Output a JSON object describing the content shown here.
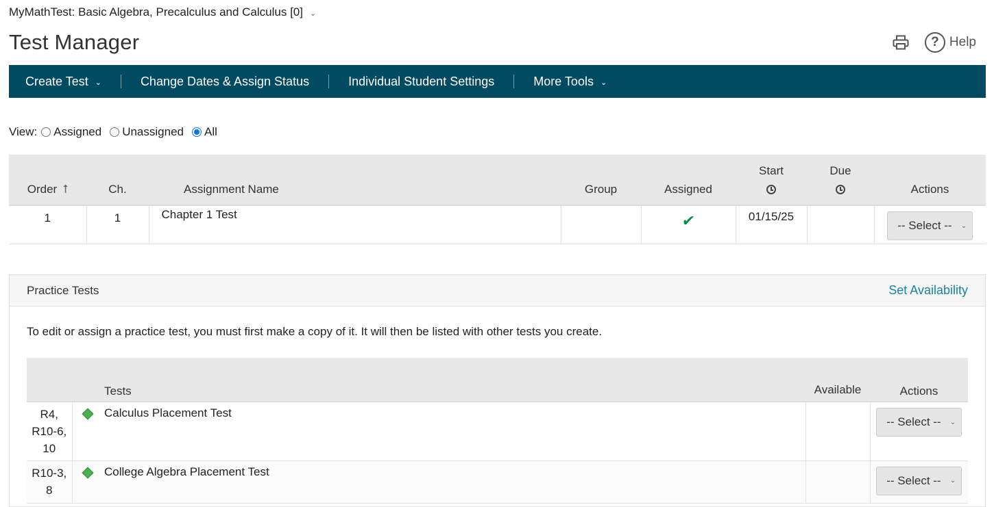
{
  "header": {
    "course_title": "MyMathTest: Basic Algebra, Precalculus and Calculus [0]",
    "course_chevron": "⌄",
    "page_title": "Test Manager",
    "help_label": "Help",
    "help_glyph": "?"
  },
  "nav": {
    "items": [
      {
        "label": "Create Test",
        "has_dropdown": true
      },
      {
        "label": "Change Dates & Assign Status",
        "has_dropdown": false
      },
      {
        "label": "Individual Student Settings",
        "has_dropdown": false
      },
      {
        "label": "More Tools",
        "has_dropdown": true
      }
    ],
    "chevron": "⌄"
  },
  "view_filter": {
    "label": "View:",
    "options": [
      {
        "label": "Assigned",
        "selected": false
      },
      {
        "label": "Unassigned",
        "selected": false
      },
      {
        "label": "All",
        "selected": true
      }
    ]
  },
  "tests_table": {
    "columns": {
      "order": "Order",
      "chapter": "Ch.",
      "name": "Assignment Name",
      "group": "Group",
      "assigned": "Assigned",
      "start": "Start",
      "due": "Due",
      "actions": "Actions"
    },
    "sort_glyph": "⭡",
    "rows": [
      {
        "order": "1",
        "chapter": "1",
        "name": "Chapter 1 Test",
        "group": "",
        "assigned_glyph": "✔",
        "start": "01/15/25",
        "due": "",
        "action": "-- Select --"
      }
    ]
  },
  "practice": {
    "title": "Practice Tests",
    "set_availability": "Set Availability",
    "note": "To edit or assign a practice test, you must first make a copy of it. It will then be listed with other tests you create.",
    "columns": {
      "tests": "Tests",
      "available": "Available",
      "actions": "Actions"
    },
    "rows": [
      {
        "chapters": [
          "R4,",
          "R10-6,",
          "10"
        ],
        "name": "Calculus Placement Test",
        "available": "",
        "action": "-- Select --"
      },
      {
        "chapters": [
          "R10-3,",
          "8"
        ],
        "name": "College Algebra Placement Test",
        "available": "",
        "action": "-- Select --"
      }
    ]
  },
  "select_chevron": "⌄",
  "colors": {
    "nav_bg": "#004a62",
    "link": "#1a7fa3",
    "check": "#0e8a4a",
    "diamond": "#4caf50",
    "header_bg": "#e8e8e8"
  }
}
